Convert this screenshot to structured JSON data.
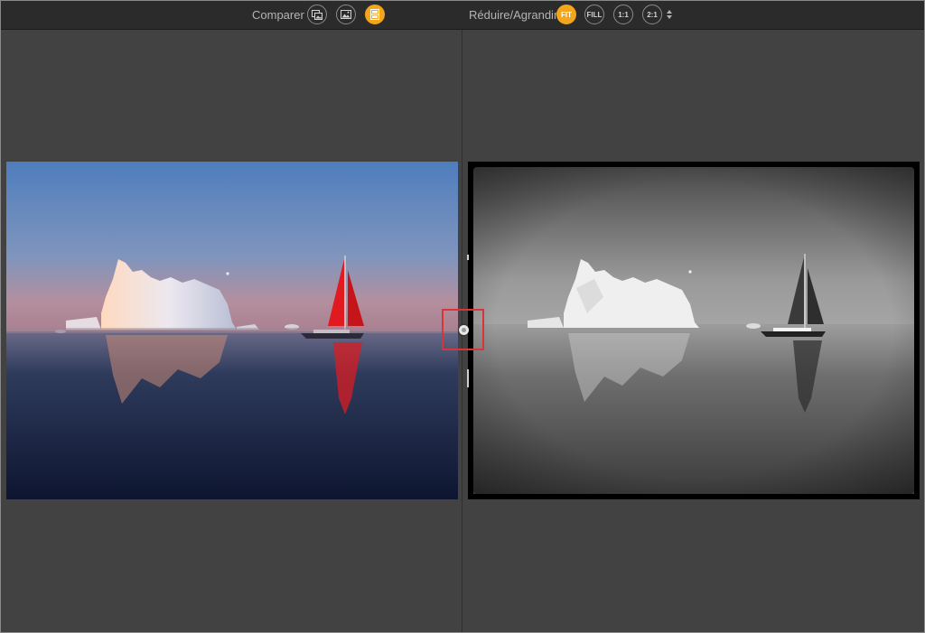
{
  "toolbar": {
    "compare_label": "Comparer",
    "zoom_label": "Réduire/Agrandir",
    "compare_buttons": [
      {
        "icon": "side-by-side-photos-icon",
        "active": false
      },
      {
        "icon": "single-photo-icon",
        "active": false
      },
      {
        "icon": "split-compare-icon",
        "active": true
      }
    ],
    "zoom_buttons": [
      {
        "label": "FIT",
        "active": true
      },
      {
        "label": "FILL",
        "active": false
      },
      {
        "label": "1:1",
        "active": false
      },
      {
        "label": "2:1",
        "active": false
      }
    ],
    "stepper_icon": "up-down-stepper-icon"
  },
  "colors": {
    "accent": "#f3a51b",
    "highlight_box": "#d8343a",
    "toolbar_bg": "#2b2b2b",
    "canvas_bg": "#424242"
  },
  "left_image": {
    "description_icon": "iceberg-red-sailboat-color-photo",
    "style": "color"
  },
  "right_image": {
    "description_icon": "iceberg-sailboat-bw-photo",
    "style": "black-and-white"
  },
  "split_handle": {
    "icon": "split-handle-icon"
  }
}
